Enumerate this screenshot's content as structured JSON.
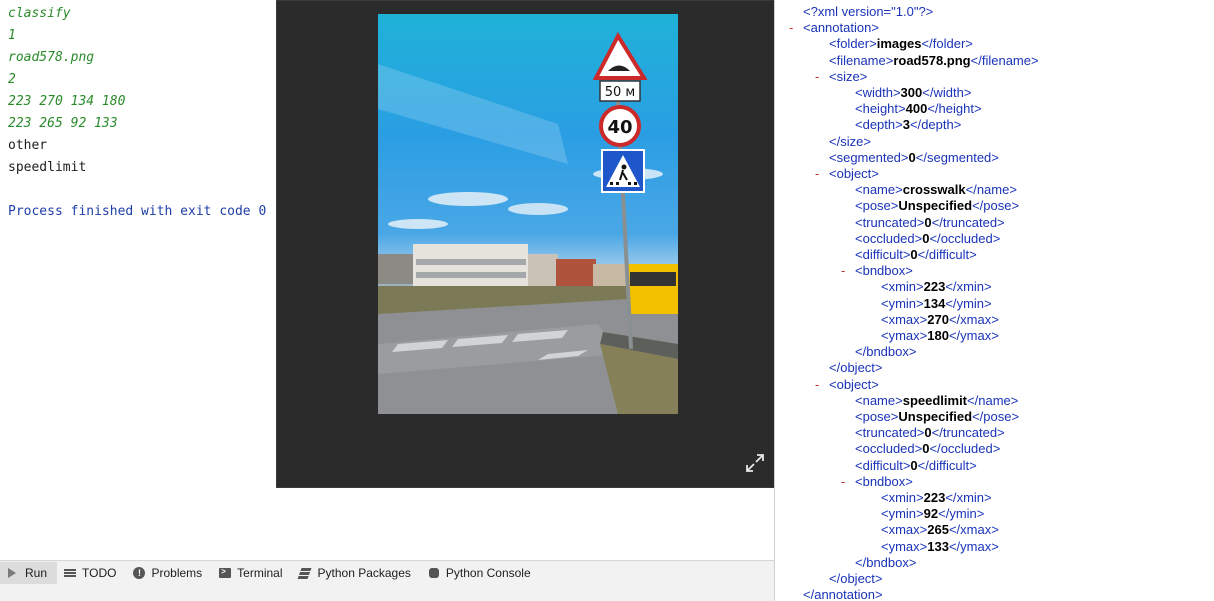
{
  "console": {
    "lines": [
      {
        "text": "classify",
        "style": "green"
      },
      {
        "text": "1",
        "style": "green"
      },
      {
        "text": "road578.png",
        "style": "green"
      },
      {
        "text": "2",
        "style": "green"
      },
      {
        "text": "223 270 134 180",
        "style": "green"
      },
      {
        "text": "223 265 92 133",
        "style": "green"
      },
      {
        "text": "other",
        "style": "plain"
      },
      {
        "text": "speedlimit",
        "style": "plain"
      },
      {
        "text": "",
        "style": "plain"
      },
      {
        "text": "Process finished with exit code 0",
        "style": "blue"
      }
    ]
  },
  "toolbar": {
    "tabs": [
      {
        "label": "Run",
        "icon": "run-icon",
        "active": true
      },
      {
        "label": "TODO",
        "icon": "todo-icon"
      },
      {
        "label": "Problems",
        "icon": "problems-icon"
      },
      {
        "label": "Terminal",
        "icon": "terminal-icon"
      },
      {
        "label": "Python Packages",
        "icon": "packages-icon"
      },
      {
        "label": "Python Console",
        "icon": "python-console-icon"
      }
    ]
  },
  "viewer": {
    "image_signs": {
      "distance_plate": "50 м",
      "speed_limit": "40"
    },
    "expand_icon": "expand-icon"
  },
  "xml": {
    "declaration": "<?xml version=\"1.0\"?>",
    "annotation_tag": "annotation",
    "folder": {
      "tag": "folder",
      "value": "images"
    },
    "filename": {
      "tag": "filename",
      "value": "road578.png"
    },
    "size_tag": "size",
    "width": {
      "tag": "width",
      "value": "300"
    },
    "height": {
      "tag": "height",
      "value": "400"
    },
    "depth": {
      "tag": "depth",
      "value": "3"
    },
    "segmented": {
      "tag": "segmented",
      "value": "0"
    },
    "object_tag": "object",
    "bndbox_tag": "bndbox",
    "objects": [
      {
        "name": "crosswalk",
        "pose": "Unspecified",
        "truncated": "0",
        "occluded": "0",
        "difficult": "0",
        "xmin": "223",
        "ymin": "134",
        "xmax": "270",
        "ymax": "180"
      },
      {
        "name": "speedlimit",
        "pose": "Unspecified",
        "truncated": "0",
        "occluded": "0",
        "difficult": "0",
        "xmin": "223",
        "ymin": "92",
        "xmax": "265",
        "ymax": "133"
      }
    ],
    "collapse_marker": "-"
  },
  "colors": {
    "console_green": "#2a8b2a",
    "console_blue": "#1f3fa8",
    "xml_tag_blue": "#1a33b8",
    "xml_minus_red": "#c2312f",
    "viewer_bg": "#2b2b2b"
  }
}
